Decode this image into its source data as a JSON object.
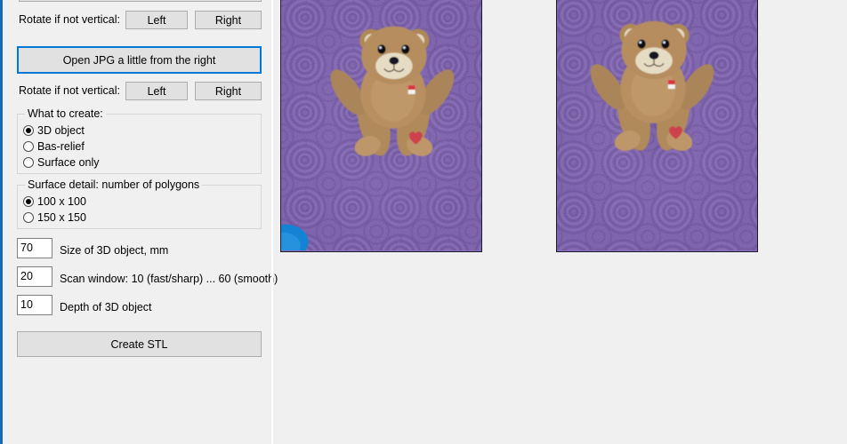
{
  "app": {
    "background_color": "#f0f0f0",
    "panel_border_color": "#1a6bb5",
    "accent_color": "#0078d7"
  },
  "left_panel": {
    "top_partial_button_label": "",
    "rotate_row_1": {
      "label": "Rotate if not vertical:",
      "left_button": "Left",
      "right_button": "Right"
    },
    "open_jpg_button": {
      "label": "Open JPG a little from the right",
      "focused": true
    },
    "rotate_row_2": {
      "label": "Rotate if not vertical:",
      "left_button": "Left",
      "right_button": "Right"
    },
    "what_to_create": {
      "title": "What to create:",
      "options": [
        {
          "label": "3D object",
          "checked": true
        },
        {
          "label": "Bas-relief",
          "checked": false
        },
        {
          "label": "Surface only",
          "checked": false
        }
      ]
    },
    "surface_detail": {
      "title": "Surface detail: number of polygons",
      "options": [
        {
          "label": "100 x 100",
          "checked": true
        },
        {
          "label": "150 x 150",
          "checked": false
        }
      ]
    },
    "fields": [
      {
        "value": "70",
        "label": "Size of 3D object, mm"
      },
      {
        "value": "20",
        "label": "Scan window: 10 (fast/sharp) ... 60 (smooth)"
      },
      {
        "value": "10",
        "label": "Depth of 3D object"
      }
    ],
    "create_stl_button": {
      "label": "Create STL"
    }
  },
  "preview": {
    "image_1": {
      "alt": "Teddy bear on purple rose-pattern carpet, blue object bottom-left",
      "carpet_color": "#8b6fbe",
      "bear_color": "#b08a5a"
    },
    "image_2": {
      "alt": "Teddy bear on purple rose-pattern carpet, shifted crop",
      "carpet_color": "#8b6fbe",
      "bear_color": "#b08a5a"
    }
  }
}
